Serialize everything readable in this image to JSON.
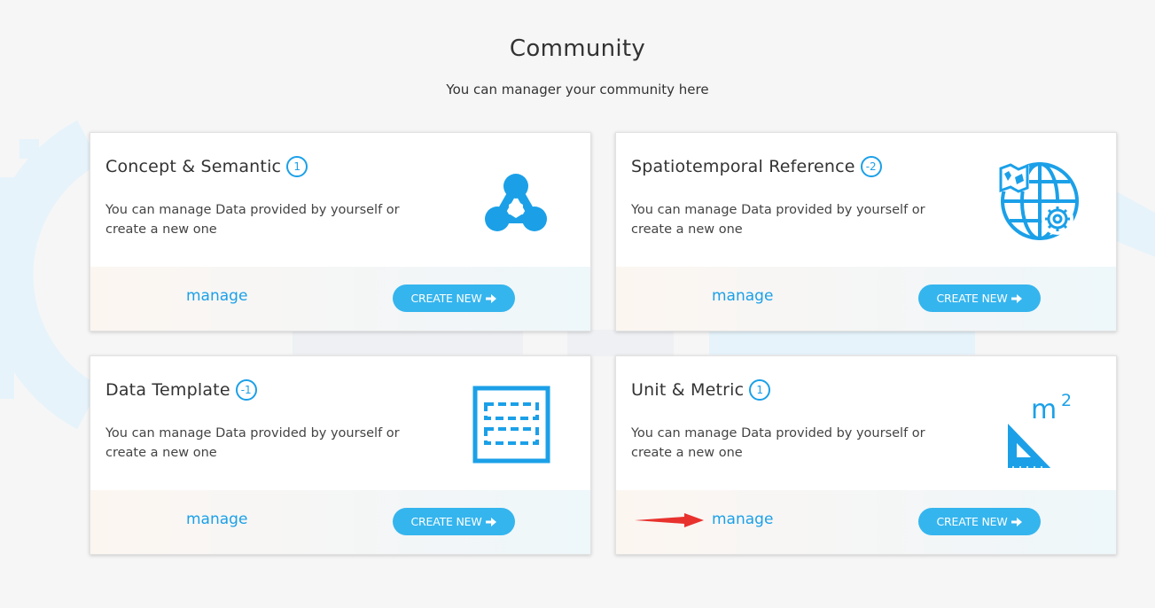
{
  "page": {
    "title": "Community",
    "subtitle": "You can manager your community here"
  },
  "cards": [
    {
      "title": "Concept & Semantic",
      "badge": "1",
      "description": "You can manage Data provided by yourself or create a new one",
      "icon": "molecule-icon",
      "manage_label": "manage",
      "create_label": "CREATE NEW"
    },
    {
      "title": "Spatiotemporal Reference",
      "badge": "-2",
      "description": "You can manage Data provided by yourself or create a new one",
      "icon": "globe-gear-icon",
      "manage_label": "manage",
      "create_label": "CREATE NEW"
    },
    {
      "title": "Data Template",
      "badge": "-1",
      "description": "You can manage Data provided by yourself or create a new one",
      "icon": "template-grid-icon",
      "manage_label": "manage",
      "create_label": "CREATE NEW"
    },
    {
      "title": "Unit & Metric",
      "badge": "1",
      "description": "You can manage Data provided by yourself or create a new one",
      "icon": "ruler-m2-icon",
      "manage_label": "manage",
      "create_label": "CREATE NEW"
    }
  ],
  "annotation": {
    "icon": "red-arrow-icon",
    "color": "#e8322e"
  },
  "colors": {
    "accent": "#1ba0e8",
    "button": "#35b5ee",
    "background": "#f6f6f6"
  }
}
